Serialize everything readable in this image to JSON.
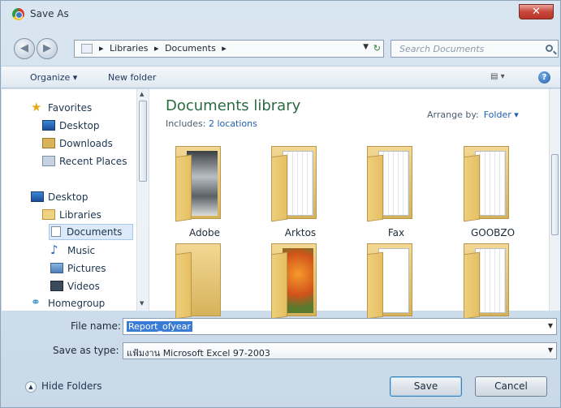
{
  "window": {
    "title": "Save As",
    "close_label": "✕"
  },
  "nav": {
    "breadcrumbs": [
      "Libraries",
      "Documents"
    ],
    "search_placeholder": "Search Documents"
  },
  "toolbar": {
    "organize_label": "Organize ▾",
    "new_folder_label": "New folder",
    "help_label": "?"
  },
  "sidebar": {
    "items": [
      {
        "label": "Favorites",
        "icon": "star-icon"
      },
      {
        "label": "Desktop",
        "icon": "desktop-icon"
      },
      {
        "label": "Downloads",
        "icon": "downloads-icon"
      },
      {
        "label": "Recent Places",
        "icon": "recent-places-icon"
      },
      {
        "label": "Desktop",
        "icon": "desktop-icon"
      },
      {
        "label": "Libraries",
        "icon": "libraries-icon"
      },
      {
        "label": "Documents",
        "icon": "document-icon"
      },
      {
        "label": "Music",
        "icon": "music-icon"
      },
      {
        "label": "Pictures",
        "icon": "pictures-icon"
      },
      {
        "label": "Videos",
        "icon": "videos-icon"
      },
      {
        "label": "Homegroup",
        "icon": "homegroup-icon"
      }
    ]
  },
  "library": {
    "title": "Documents library",
    "includes_label": "Includes:",
    "includes_link": "2 locations",
    "arrange_label": "Arrange by:",
    "arrange_value": "Folder ▾"
  },
  "folders": [
    {
      "name": "Adobe"
    },
    {
      "name": "Arktos"
    },
    {
      "name": "Fax"
    },
    {
      "name": "GOOBZO"
    },
    {
      "name": ""
    },
    {
      "name": ""
    },
    {
      "name": ""
    },
    {
      "name": ""
    }
  ],
  "form": {
    "filename_label": "File name:",
    "filename_value": "Report_ofyear",
    "savetype_label": "Save as type:",
    "savetype_value": "แฟ้มงาน Microsoft Excel 97-2003"
  },
  "footer": {
    "hide_folders_label": "Hide Folders",
    "save_label": "Save",
    "cancel_label": "Cancel"
  }
}
